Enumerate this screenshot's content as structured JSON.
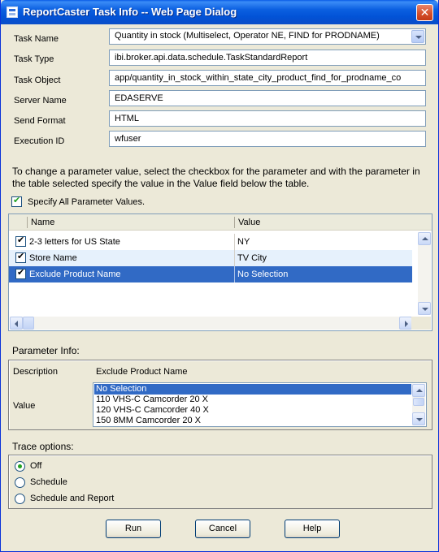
{
  "window": {
    "title": "ReportCaster Task Info -- Web Page Dialog",
    "close_glyph": "✕"
  },
  "form": {
    "task_name_label": "Task Name",
    "task_name_value": "Quantity in stock (Multiselect, Operator NE, FIND for PRODNAME)",
    "task_type_label": "Task Type",
    "task_type_value": "ibi.broker.api.data.schedule.TaskStandardReport",
    "task_object_label": "Task Object",
    "task_object_value": "app/quantity_in_stock_within_state_city_product_find_for_prodname_co",
    "server_name_label": "Server Name",
    "server_name_value": "EDASERVE",
    "send_format_label": "Send Format",
    "send_format_value": "HTML",
    "execution_id_label": "Execution ID",
    "execution_id_value": "wfuser"
  },
  "instructions": "To change a parameter value, select the checkbox for the parameter and with the parameter in the table selected specify the value in the Value field below the table.",
  "specify_all": {
    "label": "Specify All Parameter Values.",
    "checked": true
  },
  "params_table": {
    "columns": [
      "Name",
      "Value"
    ],
    "rows": [
      {
        "name": "2-3 letters for US State",
        "value": "NY",
        "checked": true
      },
      {
        "name": "Store Name",
        "value": "TV City",
        "checked": true
      },
      {
        "name": "Exclude Product Name",
        "value": "No Selection",
        "checked": true,
        "selected": true
      }
    ]
  },
  "parameter_info": {
    "title": "Parameter Info:",
    "description_label": "Description",
    "description_value": "Exclude Product Name",
    "value_label": "Value",
    "value_options": [
      "No Selection",
      "110 VHS-C Camcorder 20 X",
      "120 VHS-C Camcorder 40 X",
      "150 8MM Camcorder 20 X"
    ],
    "selected_index": 0
  },
  "trace": {
    "title": "Trace options:",
    "options": [
      "Off",
      "Schedule",
      "Schedule and Report"
    ],
    "selected_index": 0
  },
  "buttons": {
    "run": "Run",
    "cancel": "Cancel",
    "help": "Help"
  },
  "colors": {
    "titlebar": "#0b5fe0",
    "selection": "#316ac5",
    "dialog_bg": "#ece9d8"
  }
}
